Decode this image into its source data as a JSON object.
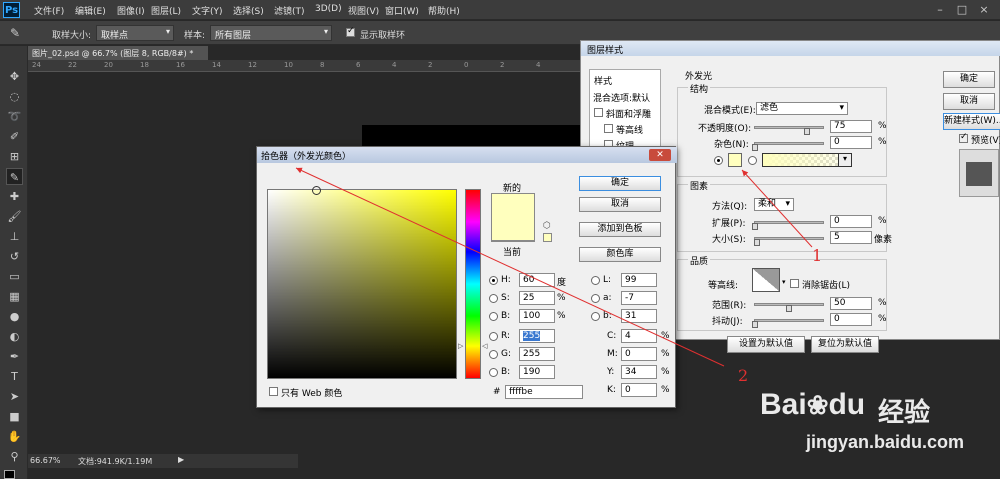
{
  "app": {
    "logo": "Ps"
  },
  "menu": [
    "文件(F)",
    "编辑(E)",
    "图像(I)",
    "图层(L)",
    "文字(Y)",
    "选择(S)",
    "滤镜(T)",
    "3D(D)",
    "视图(V)",
    "窗口(W)",
    "帮助(H)"
  ],
  "window_controls": [
    "–",
    "□",
    "×"
  ],
  "options": {
    "sample_size_label": "取样大小:",
    "sample_size_value": "取样点",
    "sample_label": "样本:",
    "sample_value": "所有图层",
    "show_ring_label": "显示取样环"
  },
  "document": {
    "tab": "图片_02.psd @ 66.7% (图层 8, RGB/8#) *",
    "ruler_ticks": [
      "24",
      "22",
      "20",
      "18",
      "16",
      "14",
      "12",
      "10",
      "8",
      "6",
      "4",
      "2",
      "0",
      "2",
      "4"
    ]
  },
  "status": {
    "zoom": "66.67%",
    "doc_info": "文档:941.9K/1.19M"
  },
  "layer_style": {
    "title": "图层样式",
    "sidebar_header": "样式",
    "sidebar_items": [
      "混合选项:默认",
      "斜面和浮雕",
      "等高线",
      "纹理"
    ],
    "section": "外发光",
    "structure": {
      "title": "结构",
      "blend_label": "混合模式(E):",
      "blend_value": "滤色",
      "opacity_label": "不透明度(O):",
      "opacity_value": "75",
      "opacity_unit": "%",
      "opacity_level": 0.75,
      "noise_label": "杂色(N):",
      "noise_value": "0",
      "noise_unit": "%"
    },
    "elements": {
      "title": "图素",
      "method_label": "方法(Q):",
      "method_value": "柔和",
      "spread_label": "扩展(P):",
      "spread_value": "0",
      "spread_unit": "%",
      "size_label": "大小(S):",
      "size_value": "5",
      "size_unit": "像素"
    },
    "quality": {
      "title": "品质",
      "contour_label": "等高线:",
      "antialias_label": "消除锯齿(L)",
      "range_label": "范围(R):",
      "range_value": "50",
      "range_unit": "%",
      "range_level": 0.5,
      "jitter_label": "抖动(J):",
      "jitter_value": "0",
      "jitter_unit": "%"
    },
    "buttons": {
      "ok": "确定",
      "cancel": "取消",
      "new_style": "新建样式(W)...",
      "preview": "预览(V)",
      "make_default": "设置为默认值",
      "reset_default": "复位为默认值"
    },
    "glow_color": "#ffffbe"
  },
  "color_picker": {
    "title": "拾色器（外发光颜色）",
    "new_label": "新的",
    "current_label": "当前",
    "new_color": "#ffffbe",
    "current_color": "#ffffbe",
    "buttons": {
      "ok": "确定",
      "cancel": "取消",
      "add_swatch": "添加到色板",
      "libraries": "颜色库"
    },
    "fields": {
      "H": {
        "label": "H:",
        "value": "60",
        "unit": "度"
      },
      "S": {
        "label": "S:",
        "value": "25",
        "unit": "%"
      },
      "Bv": {
        "label": "B:",
        "value": "100",
        "unit": "%"
      },
      "R": {
        "label": "R:",
        "value": "255"
      },
      "G": {
        "label": "G:",
        "value": "255"
      },
      "B2": {
        "label": "B:",
        "value": "190"
      },
      "L": {
        "label": "L:",
        "value": "99"
      },
      "a": {
        "label": "a:",
        "value": "-7"
      },
      "b": {
        "label": "b:",
        "value": "31"
      },
      "C": {
        "label": "C:",
        "value": "4",
        "unit": "%"
      },
      "M": {
        "label": "M:",
        "value": "0",
        "unit": "%"
      },
      "Y": {
        "label": "Y:",
        "value": "34",
        "unit": "%"
      },
      "K": {
        "label": "K:",
        "value": "0",
        "unit": "%"
      }
    },
    "hex_label": "#",
    "hex_value": "ffffbe",
    "web_only_label": "只有 Web 颜色"
  },
  "annotations": {
    "n1": "1",
    "n2": "2",
    "arrow_color": "#e03030"
  },
  "watermark": {
    "brand": "Bai",
    "brand2": "du",
    "suffix": "经验",
    "url": "jingyan.baidu.com"
  }
}
